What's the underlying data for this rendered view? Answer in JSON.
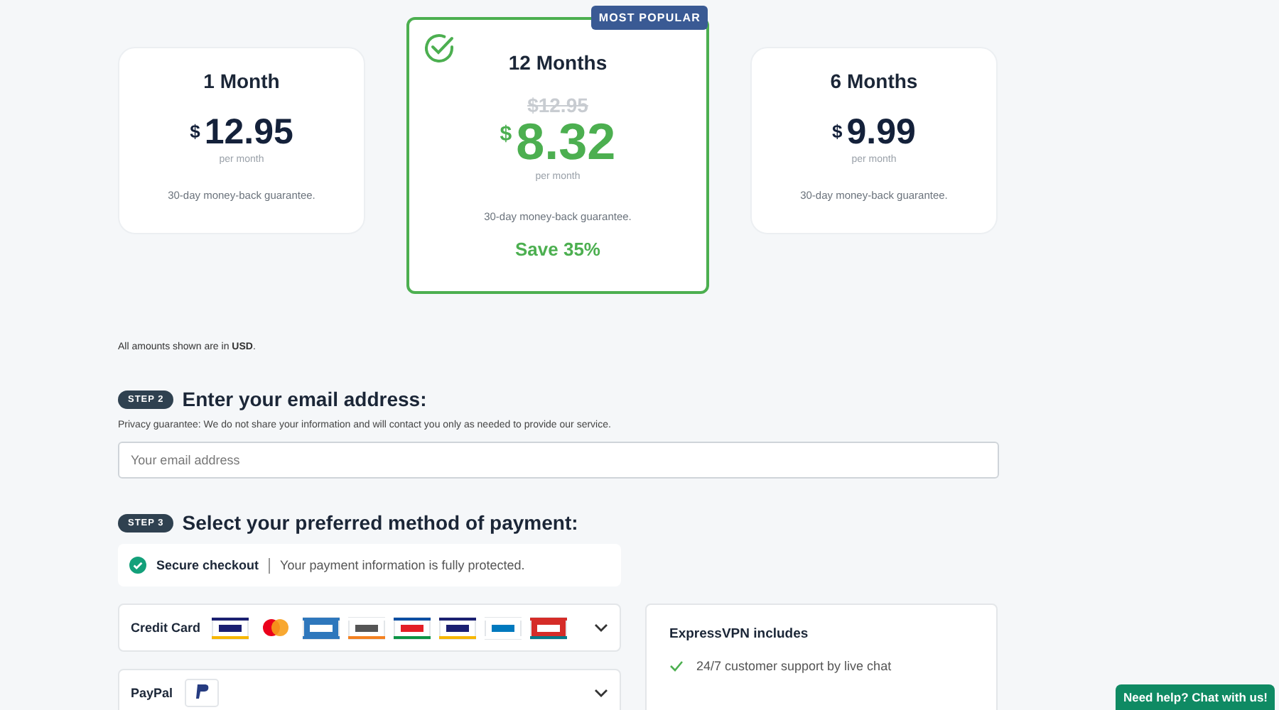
{
  "plans": [
    {
      "title": "1 Month",
      "currency": "$",
      "price": "12.95",
      "period": "per month",
      "guarantee": "30-day money-back guarantee.",
      "selected": false
    },
    {
      "title": "12 Months",
      "currency": "$",
      "price": "8.32",
      "old_price": "$12.95",
      "period": "per month",
      "guarantee": "30-day money-back guarantee.",
      "savings": "Save 35%",
      "badge": "MOST POPULAR",
      "selected": true
    },
    {
      "title": "6 Months",
      "currency": "$",
      "price": "9.99",
      "period": "per month",
      "guarantee": "30-day money-back guarantee.",
      "selected": false
    }
  ],
  "currency_note": "All amounts shown are in **USD**.",
  "email_step": {
    "step": "STEP 2",
    "heading": "Enter your email address:",
    "note": "Privacy guarantee: We do not share your information and will contact you only as needed to provide our service.",
    "placeholder": "Your email address"
  },
  "payment_step": {
    "step": "STEP 3",
    "heading": "Select your preferred method of payment:",
    "secure_label": "Secure checkout",
    "secure_text": "Your payment information is fully protected.",
    "methods": [
      {
        "name": "Credit Card",
        "kind": "cards"
      },
      {
        "name": "PayPal",
        "kind": "paypal"
      }
    ]
  },
  "includes": {
    "title": "ExpressVPN includes",
    "items": [
      "24/7 customer support by live chat"
    ]
  },
  "chat_button": "Need help? Chat with us!"
}
